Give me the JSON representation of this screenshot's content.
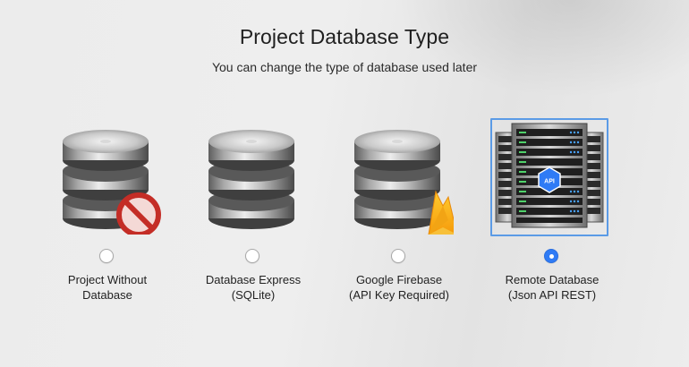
{
  "header": {
    "title": "Project Database Type",
    "subtitle": "You can change the type of database used later"
  },
  "options": [
    {
      "line1": "Project Without",
      "line2": "Database",
      "icon": "database-no-icon",
      "selected": false
    },
    {
      "line1": "Database Express",
      "line2": "(SQLite)",
      "icon": "database-icon",
      "selected": false
    },
    {
      "line1": "Google Firebase",
      "line2": "(API Key Required)",
      "icon": "database-firebase-icon",
      "selected": false
    },
    {
      "line1": "Remote Database",
      "line2": "(Json API REST)",
      "icon": "server-rack-api-icon",
      "api_badge": "API",
      "selected": true
    }
  ],
  "colors": {
    "accent": "#2f7bf5",
    "selection_border": "#5b9be6",
    "no_symbol": "#d0332c",
    "firebase": "#f7b731"
  }
}
